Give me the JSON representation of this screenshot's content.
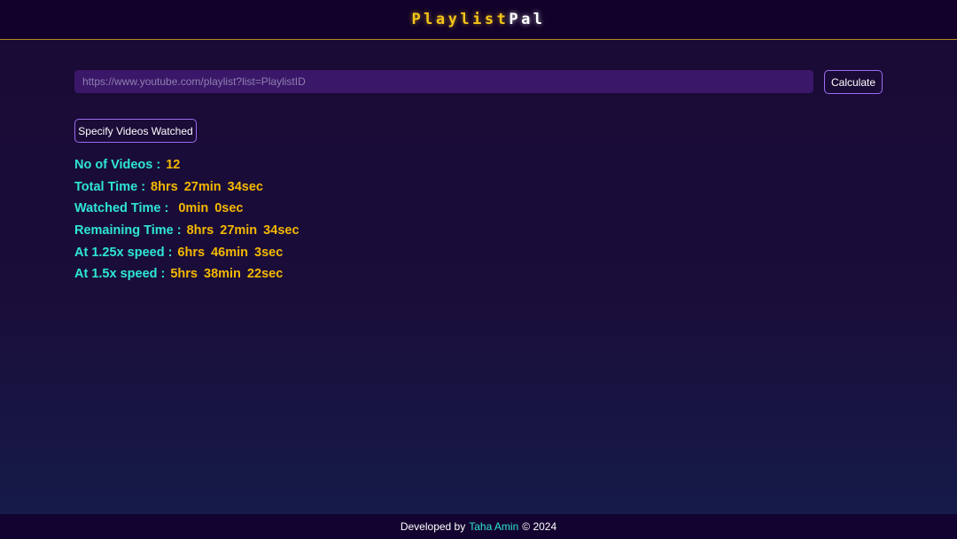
{
  "header": {
    "logo_part1": "Playlist",
    "logo_part2": "Pal"
  },
  "form": {
    "url_placeholder": "https://www.youtube.com/playlist?list=PlaylistID",
    "url_value": "",
    "calculate_label": "Calculate",
    "specify_label": "Specify Videos Watched"
  },
  "stats": [
    {
      "label": "No of Videos :",
      "value": "12"
    },
    {
      "label": "Total Time :",
      "value": "8hrs 27min 34sec"
    },
    {
      "label": "Watched Time :",
      "value": "0min 0sec"
    },
    {
      "label": "Remaining Time :",
      "value": "8hrs 27min 34sec"
    },
    {
      "label": "At 1.25x speed :",
      "value": "6hrs 46min 3sec"
    },
    {
      "label": "At 1.5x speed :",
      "value": "5hrs 38min 22sec"
    }
  ],
  "footer": {
    "prefix": "Developed by",
    "author": "Taha Amin",
    "suffix": "© 2024"
  },
  "colors": {
    "label": "#2ee6d6",
    "value": "#f5b800",
    "accent_border": "#9c6cf0",
    "header_line": "#b08a1e"
  }
}
